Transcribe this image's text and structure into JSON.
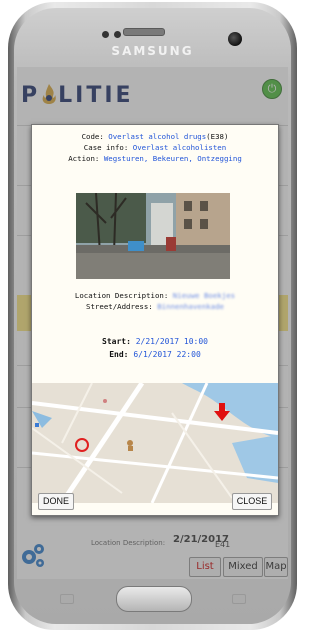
{
  "device": {
    "brand": "SAMSUNG"
  },
  "app": {
    "logo_text": "LITIE",
    "logo_letter": "P"
  },
  "background": {
    "bottom_location_label": "Location Description:",
    "bottom_date": "2/21/2017",
    "bottom_code": "E41",
    "tabs": [
      {
        "label": "List"
      },
      {
        "label": "Mixed"
      },
      {
        "label": "Map"
      }
    ]
  },
  "dialog": {
    "code_label": "Code:",
    "code_value": "Overlast alcohol drugs",
    "code_suffix": "(E38)",
    "case_label": "Case info:",
    "case_value": "Overlast alcoholisten",
    "action_label": "Action:",
    "action_value": "Wegsturen, Bekeuren, Ontzegging",
    "location_label": "Location Description:",
    "location_value": "Nieuwe Boekjes",
    "street_label": "Street/Address:",
    "street_value": "Binnenhavenkade",
    "start_label": "Start:",
    "start_value": "2/21/2017 10:00",
    "end_label": "End:",
    "end_value": "6/1/2017 22:00",
    "done_label": "DONE",
    "close_label": "CLOSE"
  },
  "colors": {
    "accent_blue": "#2255d8",
    "list_red": "#cc0000",
    "power_green": "#4cbb3a"
  }
}
